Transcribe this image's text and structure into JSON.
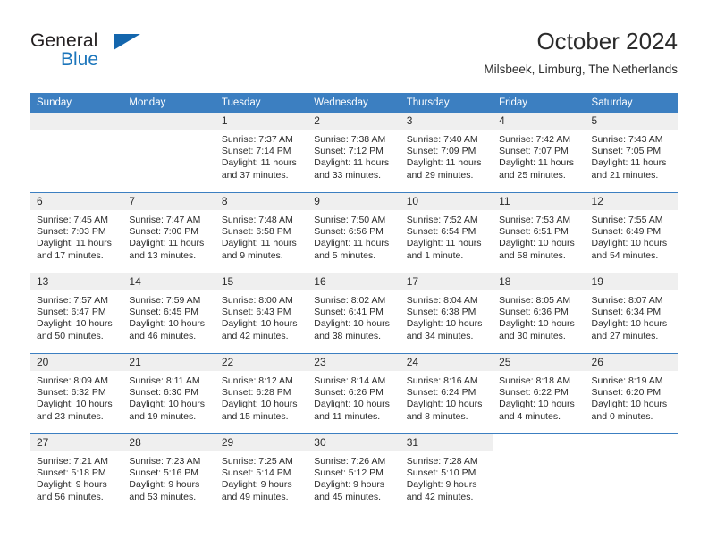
{
  "brand": {
    "name_part1": "General",
    "name_part2": "Blue",
    "triangle_color": "#1466ad",
    "blue_color": "#1b75bb"
  },
  "header": {
    "title": "October 2024",
    "subtitle": "Milsbeek, Limburg, The Netherlands"
  },
  "theme": {
    "header_row_bg": "#3c7fc1",
    "daynum_bg": "#efefef",
    "text_color": "#2b2b2b"
  },
  "weekdays": [
    "Sunday",
    "Monday",
    "Tuesday",
    "Wednesday",
    "Thursday",
    "Friday",
    "Saturday"
  ],
  "labels": {
    "sunrise_prefix": "Sunrise:",
    "sunset_prefix": "Sunset:",
    "daylight_prefix": "Daylight:"
  },
  "weeks": [
    [
      {
        "day": "",
        "empty": true
      },
      {
        "day": "",
        "empty": true
      },
      {
        "day": "1",
        "sunrise": "Sunrise: 7:37 AM",
        "sunset": "Sunset: 7:14 PM",
        "daylight": "Daylight: 11 hours and 37 minutes."
      },
      {
        "day": "2",
        "sunrise": "Sunrise: 7:38 AM",
        "sunset": "Sunset: 7:12 PM",
        "daylight": "Daylight: 11 hours and 33 minutes."
      },
      {
        "day": "3",
        "sunrise": "Sunrise: 7:40 AM",
        "sunset": "Sunset: 7:09 PM",
        "daylight": "Daylight: 11 hours and 29 minutes."
      },
      {
        "day": "4",
        "sunrise": "Sunrise: 7:42 AM",
        "sunset": "Sunset: 7:07 PM",
        "daylight": "Daylight: 11 hours and 25 minutes."
      },
      {
        "day": "5",
        "sunrise": "Sunrise: 7:43 AM",
        "sunset": "Sunset: 7:05 PM",
        "daylight": "Daylight: 11 hours and 21 minutes."
      }
    ],
    [
      {
        "day": "6",
        "sunrise": "Sunrise: 7:45 AM",
        "sunset": "Sunset: 7:03 PM",
        "daylight": "Daylight: 11 hours and 17 minutes."
      },
      {
        "day": "7",
        "sunrise": "Sunrise: 7:47 AM",
        "sunset": "Sunset: 7:00 PM",
        "daylight": "Daylight: 11 hours and 13 minutes."
      },
      {
        "day": "8",
        "sunrise": "Sunrise: 7:48 AM",
        "sunset": "Sunset: 6:58 PM",
        "daylight": "Daylight: 11 hours and 9 minutes."
      },
      {
        "day": "9",
        "sunrise": "Sunrise: 7:50 AM",
        "sunset": "Sunset: 6:56 PM",
        "daylight": "Daylight: 11 hours and 5 minutes."
      },
      {
        "day": "10",
        "sunrise": "Sunrise: 7:52 AM",
        "sunset": "Sunset: 6:54 PM",
        "daylight": "Daylight: 11 hours and 1 minute."
      },
      {
        "day": "11",
        "sunrise": "Sunrise: 7:53 AM",
        "sunset": "Sunset: 6:51 PM",
        "daylight": "Daylight: 10 hours and 58 minutes."
      },
      {
        "day": "12",
        "sunrise": "Sunrise: 7:55 AM",
        "sunset": "Sunset: 6:49 PM",
        "daylight": "Daylight: 10 hours and 54 minutes."
      }
    ],
    [
      {
        "day": "13",
        "sunrise": "Sunrise: 7:57 AM",
        "sunset": "Sunset: 6:47 PM",
        "daylight": "Daylight: 10 hours and 50 minutes."
      },
      {
        "day": "14",
        "sunrise": "Sunrise: 7:59 AM",
        "sunset": "Sunset: 6:45 PM",
        "daylight": "Daylight: 10 hours and 46 minutes."
      },
      {
        "day": "15",
        "sunrise": "Sunrise: 8:00 AM",
        "sunset": "Sunset: 6:43 PM",
        "daylight": "Daylight: 10 hours and 42 minutes."
      },
      {
        "day": "16",
        "sunrise": "Sunrise: 8:02 AM",
        "sunset": "Sunset: 6:41 PM",
        "daylight": "Daylight: 10 hours and 38 minutes."
      },
      {
        "day": "17",
        "sunrise": "Sunrise: 8:04 AM",
        "sunset": "Sunset: 6:38 PM",
        "daylight": "Daylight: 10 hours and 34 minutes."
      },
      {
        "day": "18",
        "sunrise": "Sunrise: 8:05 AM",
        "sunset": "Sunset: 6:36 PM",
        "daylight": "Daylight: 10 hours and 30 minutes."
      },
      {
        "day": "19",
        "sunrise": "Sunrise: 8:07 AM",
        "sunset": "Sunset: 6:34 PM",
        "daylight": "Daylight: 10 hours and 27 minutes."
      }
    ],
    [
      {
        "day": "20",
        "sunrise": "Sunrise: 8:09 AM",
        "sunset": "Sunset: 6:32 PM",
        "daylight": "Daylight: 10 hours and 23 minutes."
      },
      {
        "day": "21",
        "sunrise": "Sunrise: 8:11 AM",
        "sunset": "Sunset: 6:30 PM",
        "daylight": "Daylight: 10 hours and 19 minutes."
      },
      {
        "day": "22",
        "sunrise": "Sunrise: 8:12 AM",
        "sunset": "Sunset: 6:28 PM",
        "daylight": "Daylight: 10 hours and 15 minutes."
      },
      {
        "day": "23",
        "sunrise": "Sunrise: 8:14 AM",
        "sunset": "Sunset: 6:26 PM",
        "daylight": "Daylight: 10 hours and 11 minutes."
      },
      {
        "day": "24",
        "sunrise": "Sunrise: 8:16 AM",
        "sunset": "Sunset: 6:24 PM",
        "daylight": "Daylight: 10 hours and 8 minutes."
      },
      {
        "day": "25",
        "sunrise": "Sunrise: 8:18 AM",
        "sunset": "Sunset: 6:22 PM",
        "daylight": "Daylight: 10 hours and 4 minutes."
      },
      {
        "day": "26",
        "sunrise": "Sunrise: 8:19 AM",
        "sunset": "Sunset: 6:20 PM",
        "daylight": "Daylight: 10 hours and 0 minutes."
      }
    ],
    [
      {
        "day": "27",
        "sunrise": "Sunrise: 7:21 AM",
        "sunset": "Sunset: 5:18 PM",
        "daylight": "Daylight: 9 hours and 56 minutes."
      },
      {
        "day": "28",
        "sunrise": "Sunrise: 7:23 AM",
        "sunset": "Sunset: 5:16 PM",
        "daylight": "Daylight: 9 hours and 53 minutes."
      },
      {
        "day": "29",
        "sunrise": "Sunrise: 7:25 AM",
        "sunset": "Sunset: 5:14 PM",
        "daylight": "Daylight: 9 hours and 49 minutes."
      },
      {
        "day": "30",
        "sunrise": "Sunrise: 7:26 AM",
        "sunset": "Sunset: 5:12 PM",
        "daylight": "Daylight: 9 hours and 45 minutes."
      },
      {
        "day": "31",
        "sunrise": "Sunrise: 7:28 AM",
        "sunset": "Sunset: 5:10 PM",
        "daylight": "Daylight: 9 hours and 42 minutes."
      },
      {
        "day": "",
        "blank": true
      },
      {
        "day": "",
        "blank": true
      }
    ]
  ]
}
